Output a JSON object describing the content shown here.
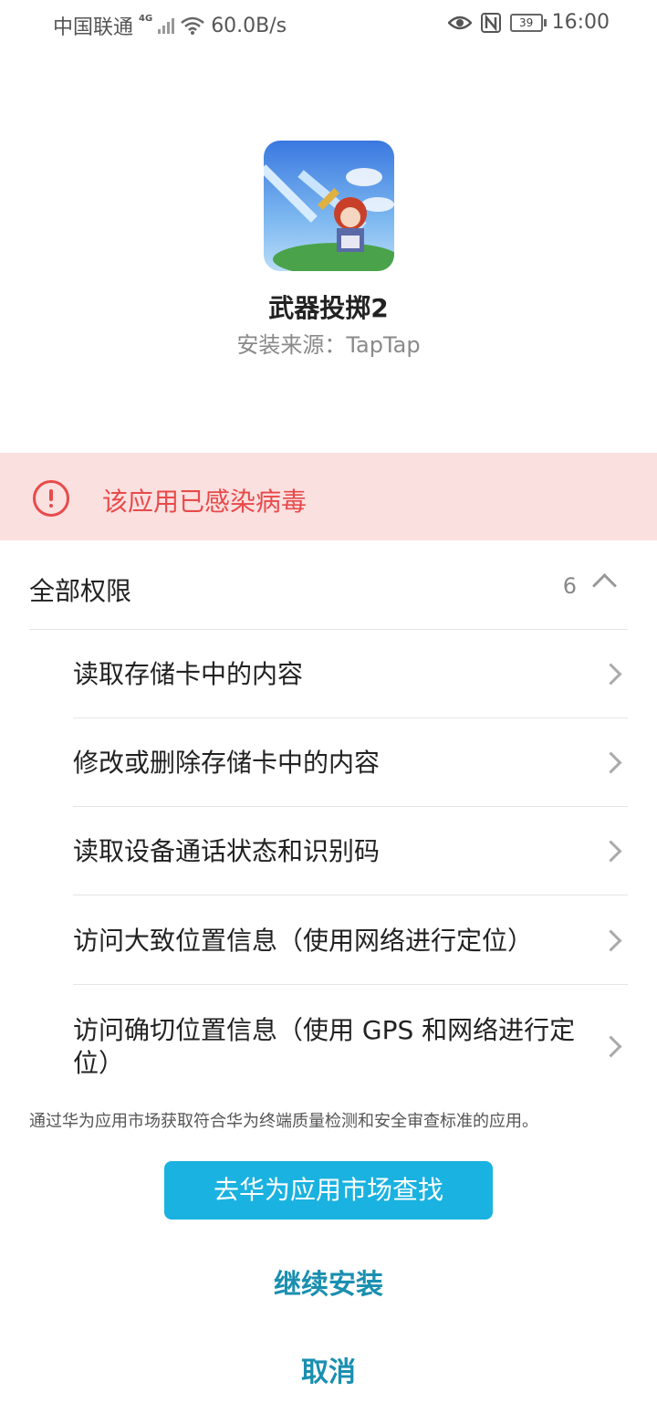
{
  "status_bar": {
    "carrier": "中国联通",
    "network": "4G",
    "speed": "60.0B/s",
    "battery": "39",
    "time": "16:00"
  },
  "app": {
    "name": "武器投掷2",
    "source": "安装来源：TapTap"
  },
  "warning": {
    "text": "该应用已感染病毒",
    "color": "#e84a4a",
    "background": "#fbe0e0"
  },
  "permissions": {
    "title": "全部权限",
    "count": "6",
    "items": [
      "读取存储卡中的内容",
      "修改或删除存储卡中的内容",
      "读取设备通话状态和识别码",
      "访问大致位置信息（使用网络进行定位）",
      "访问确切位置信息（使用 GPS 和网络进行定位）"
    ]
  },
  "footnote": "通过华为应用市场获取符合华为终端质量检测和安全审查标准的应用。",
  "buttons": {
    "primary": "去华为应用市场查找",
    "continue": "继续安装",
    "cancel": "取消"
  },
  "colors": {
    "primary_button": "#1ab2e0",
    "link": "#1a8fb0"
  }
}
